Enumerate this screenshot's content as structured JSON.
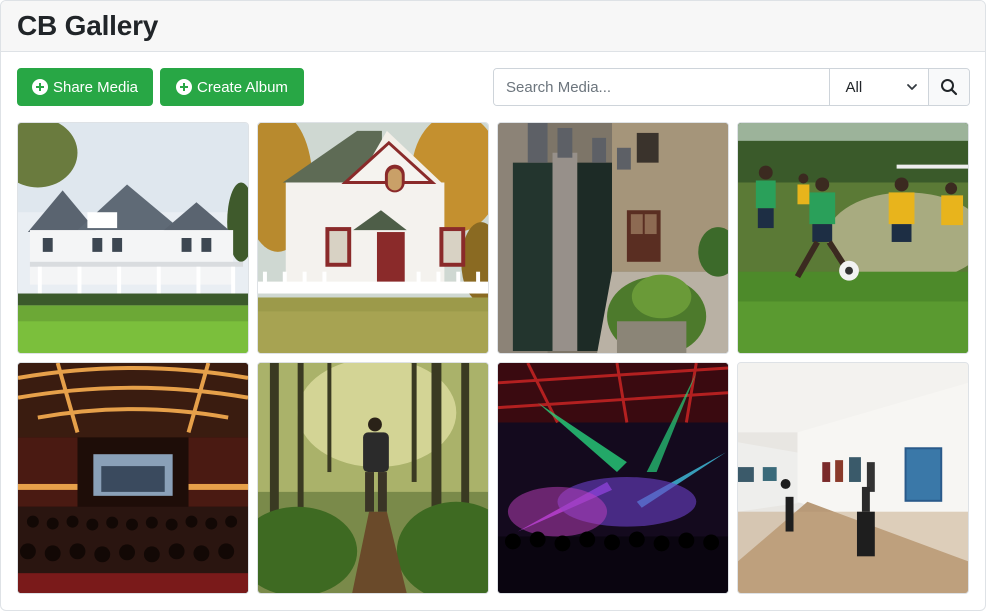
{
  "app": {
    "title": "CB Gallery"
  },
  "toolbar": {
    "share_label": "Share Media",
    "album_label": "Create Album",
    "accent_color": "#28a745"
  },
  "search": {
    "placeholder": "Search Media...",
    "value": "",
    "filter_selected": "All"
  },
  "gallery": {
    "items": [
      {
        "icon": "house-photo"
      },
      {
        "icon": "cottage-photo"
      },
      {
        "icon": "alley-photo"
      },
      {
        "icon": "soccer-photo"
      },
      {
        "icon": "cinema-photo"
      },
      {
        "icon": "forest-hiker-photo"
      },
      {
        "icon": "concert-photo"
      },
      {
        "icon": "gallery-photo"
      }
    ]
  }
}
